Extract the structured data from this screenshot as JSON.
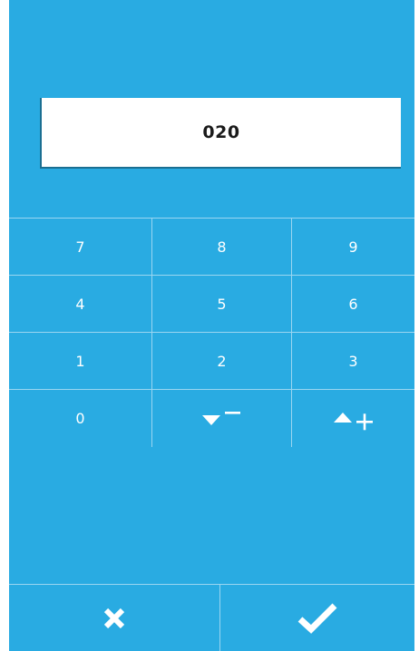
{
  "display": {
    "value": "020"
  },
  "keypad": {
    "rows": [
      [
        "7",
        "8",
        "9"
      ],
      [
        "4",
        "5",
        "6"
      ],
      [
        "1",
        "2",
        "3"
      ]
    ],
    "zero_label": "0",
    "decrement_icon": "triangle-down-minus-icon",
    "increment_icon": "triangle-up-plus-icon"
  },
  "actions": {
    "cancel_icon": "close-icon",
    "confirm_icon": "checkmark-icon"
  },
  "colors": {
    "background": "#29abe2",
    "divider": "#9ad6f1",
    "display_bg": "#ffffff",
    "text": "#ffffff"
  }
}
